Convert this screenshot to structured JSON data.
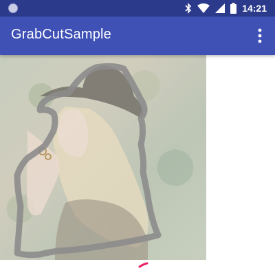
{
  "status_bar": {
    "time": "14:21",
    "icons": [
      "notification-dot-icon",
      "bluetooth-icon",
      "wifi-icon",
      "signal-icon",
      "battery-icon"
    ]
  },
  "app_bar": {
    "title": "GrabCutSample",
    "menu_icon": "more-vert-icon"
  },
  "canvas": {
    "image": "portrait-photo-with-hat",
    "stroke_color": "#8c8c8c",
    "marker_color": "#e91e63"
  },
  "colors": {
    "status_bar": "#2c3a8c",
    "app_bar": "#3f51b5",
    "background": "#ffffff"
  }
}
